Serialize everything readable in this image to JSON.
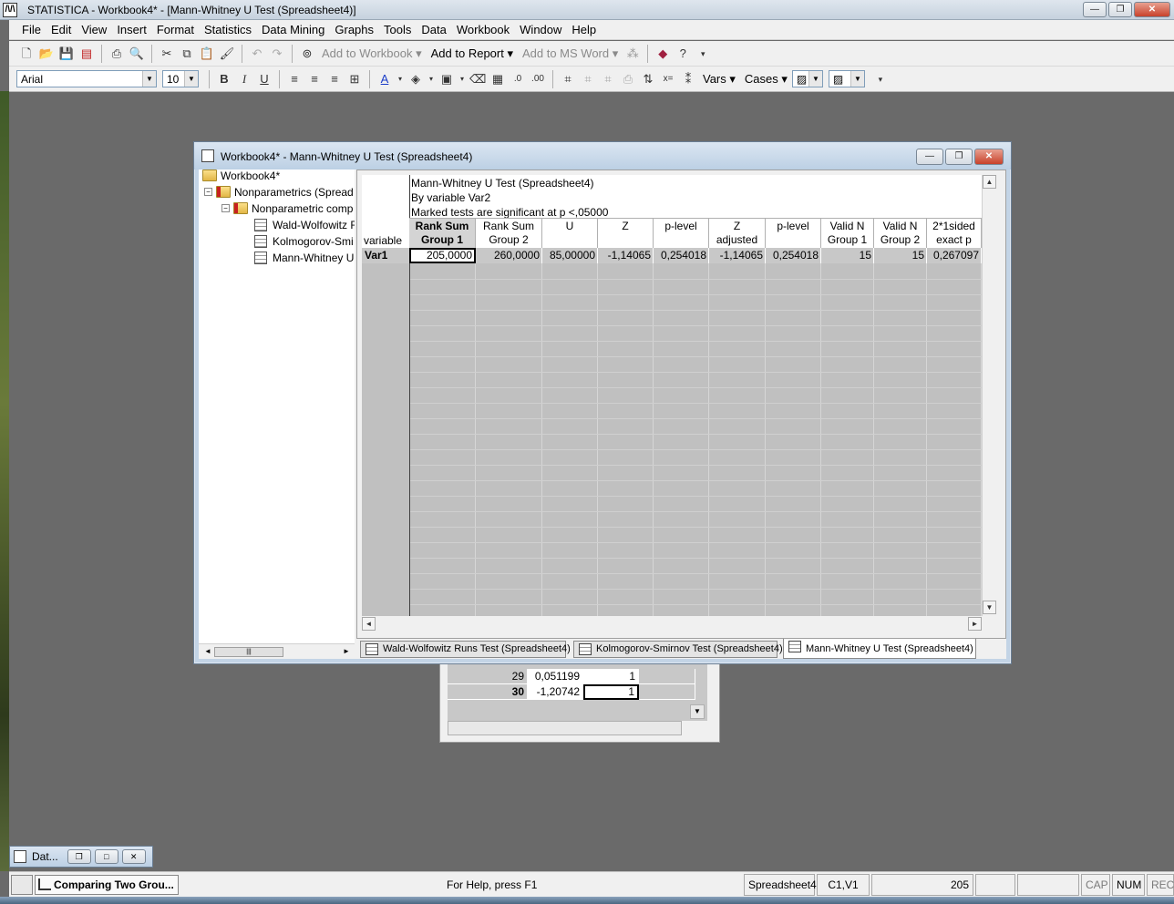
{
  "app": {
    "title": "STATISTICA - Workbook4* - [Mann-Whitney U Test (Spreadsheet4)]",
    "logo": "/\\/\\",
    "controls": {
      "minimize": "—",
      "restore": "❐",
      "close": "✕"
    }
  },
  "menu": [
    "File",
    "Edit",
    "View",
    "Insert",
    "Format",
    "Statistics",
    "Data Mining",
    "Graphs",
    "Tools",
    "Data",
    "Workbook",
    "Window",
    "Help"
  ],
  "toolbar1": {
    "add_to_workbook": "Add to Workbook ▾",
    "add_to_report": "Add to Report ▾",
    "add_to_ms_word": "Add to MS Word ▾"
  },
  "toolbar2": {
    "font": "Arial",
    "font_size": "10",
    "bold": "B",
    "italic": "I",
    "underline": "U",
    "vars": "Vars ▾",
    "cases": "Cases ▾"
  },
  "workbook": {
    "title": "Workbook4* - Mann-Whitney U Test (Spreadsheet4)",
    "tree": {
      "root": "Workbook4*",
      "node1": "Nonparametrics (Spread",
      "node2": "Nonparametric comp",
      "leaf1": "Wald-Wolfowitz R",
      "leaf2": "Kolmogorov-Smi",
      "leaf3": "Mann-Whitney U"
    },
    "sheet": {
      "info": [
        "Mann-Whitney U Test (Spreadsheet4)",
        "By variable Var2",
        "Marked tests are significant at p <,05000"
      ],
      "row_header_label": "variable",
      "columns": [
        "Rank Sum\nGroup 1",
        "Rank Sum\nGroup 2",
        "U",
        "Z",
        "p-level",
        "Z\nadjusted",
        "p-level",
        "Valid N\nGroup 1",
        "Valid N\nGroup 2",
        "2*1sided\nexact p"
      ],
      "col_head_lines": [
        [
          "Rank Sum",
          "Group 1"
        ],
        [
          "Rank Sum",
          "Group 2"
        ],
        [
          "U",
          ""
        ],
        [
          "Z",
          ""
        ],
        [
          "p-level",
          ""
        ],
        [
          "Z",
          "adjusted"
        ],
        [
          "p-level",
          ""
        ],
        [
          "Valid N",
          "Group 1"
        ],
        [
          "Valid N",
          "Group 2"
        ],
        [
          "2*1sided",
          "exact p"
        ]
      ],
      "rows": [
        {
          "label": "Var1",
          "values": [
            "205,0000",
            "260,0000",
            "85,00000",
            "-1,14065",
            "0,254018",
            "-1,14065",
            "0,254018",
            "15",
            "15",
            "0,267097"
          ]
        }
      ]
    },
    "tabs": [
      "Wald-Wolfowitz Runs Test (Spreadsheet4)",
      "Kolmogorov-Smirnov Test (Spreadsheet4)",
      "Mann-Whitney U Test (Spreadsheet4)"
    ]
  },
  "background_sheet": {
    "rows": [
      {
        "n": "29",
        "v": "0,051199",
        "g": "1"
      },
      {
        "n": "30",
        "v": "-1,20742",
        "g": "1"
      }
    ]
  },
  "minimized": {
    "title": "Dat..."
  },
  "taskbar": {
    "item": "Comparing Two Grou..."
  },
  "status": {
    "help": "For Help, press F1",
    "sheet": "Spreadsheet4",
    "cell": "C1,V1",
    "value": "205",
    "cap": "CAP",
    "num": "NUM",
    "rec": "REC"
  }
}
